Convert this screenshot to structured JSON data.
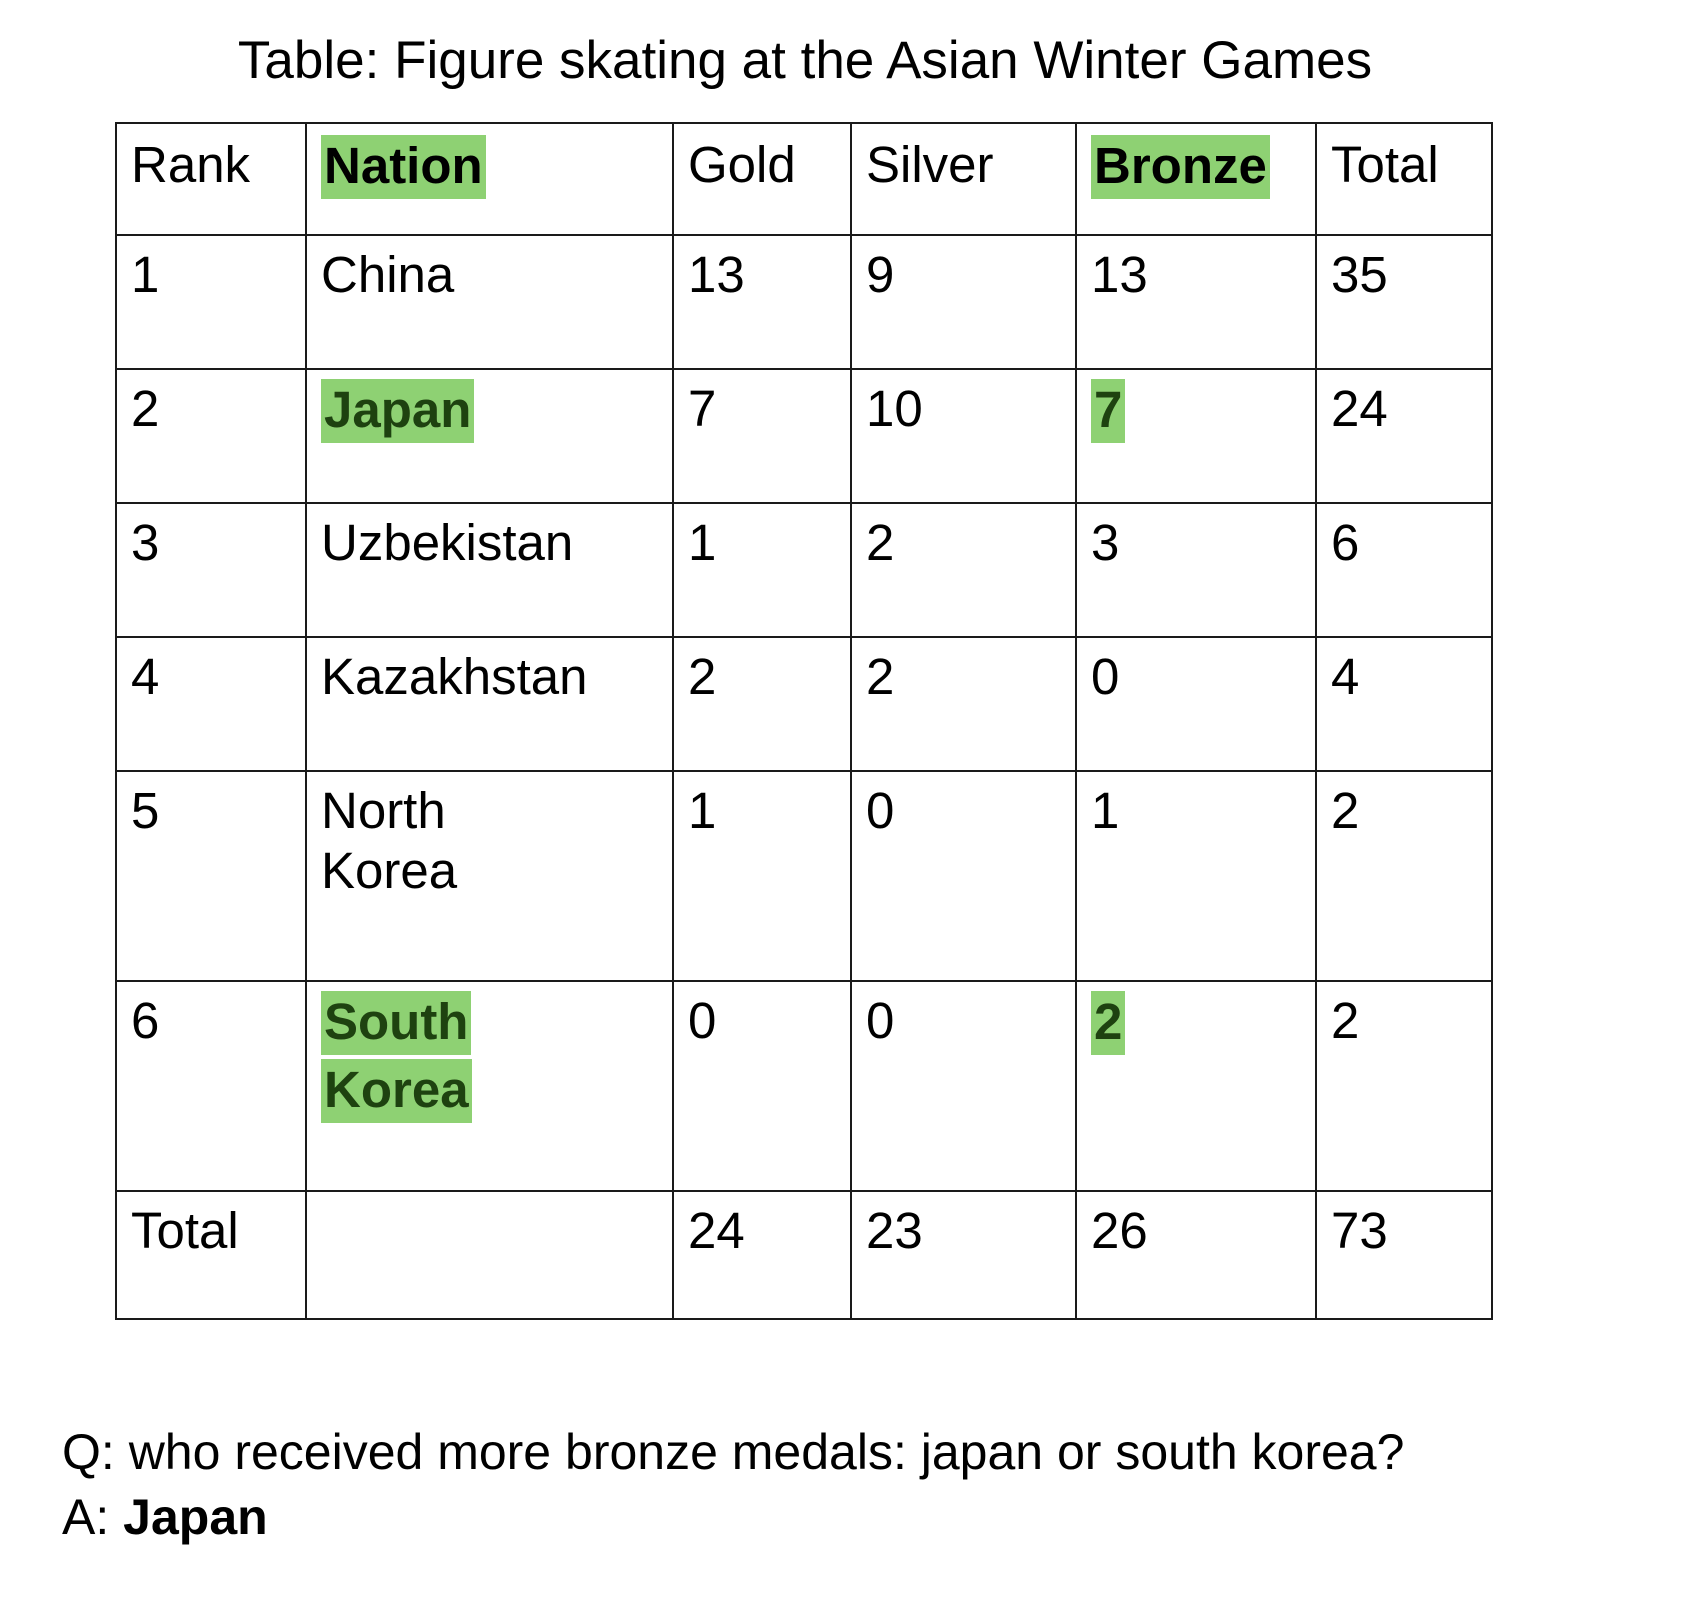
{
  "title": "Table: Figure skating at the Asian Winter Games",
  "highlight_color": "#8ed173",
  "highlight_text_color": "#1e4210",
  "table": {
    "columns": [
      {
        "key": "rank",
        "label": "Rank",
        "highlighted": false
      },
      {
        "key": "nation",
        "label": "Nation",
        "highlighted": true
      },
      {
        "key": "gold",
        "label": "Gold",
        "highlighted": false
      },
      {
        "key": "silver",
        "label": "Silver",
        "highlighted": false
      },
      {
        "key": "bronze",
        "label": "Bronze",
        "highlighted": true
      },
      {
        "key": "total",
        "label": "Total",
        "highlighted": false
      }
    ],
    "rows": [
      {
        "rank": "1",
        "nation": "China",
        "nation_line2": "",
        "gold": "13",
        "silver": "9",
        "bronze": "13",
        "total": "35"
      },
      {
        "rank": "2",
        "nation": "Japan",
        "nation_line2": "",
        "gold": "7",
        "silver": "10",
        "bronze": "7",
        "total": "24"
      },
      {
        "rank": "3",
        "nation": "Uzbekistan",
        "nation_line2": "",
        "gold": "1",
        "silver": "2",
        "bronze": "3",
        "total": "6"
      },
      {
        "rank": "4",
        "nation": "Kazakhstan",
        "nation_line2": "",
        "gold": "2",
        "silver": "2",
        "bronze": "0",
        "total": "4"
      },
      {
        "rank": "5",
        "nation": "North",
        "nation_line2": "Korea",
        "gold": "1",
        "silver": "0",
        "bronze": "1",
        "total": "2"
      },
      {
        "rank": "6",
        "nation": "South",
        "nation_line2": "Korea",
        "gold": "0",
        "silver": "0",
        "bronze": "2",
        "total": "2"
      }
    ],
    "total_row": {
      "rank": "Total",
      "nation": "",
      "gold": "24",
      "silver": "23",
      "bronze": "26",
      "total": "73"
    }
  },
  "qa": {
    "question_prefix": "Q:",
    "question": "who received more bronze medals: japan or south korea?",
    "answer_prefix": "A:",
    "answer": "Japan"
  },
  "chart_data": {
    "type": "table",
    "title": "Table: Figure skating at the Asian Winter Games",
    "columns": [
      "Rank",
      "Nation",
      "Gold",
      "Silver",
      "Bronze",
      "Total"
    ],
    "rows": [
      [
        "1",
        "China",
        13,
        9,
        13,
        35
      ],
      [
        "2",
        "Japan",
        7,
        10,
        7,
        24
      ],
      [
        "3",
        "Uzbekistan",
        1,
        2,
        3,
        6
      ],
      [
        "4",
        "Kazakhstan",
        2,
        2,
        0,
        4
      ],
      [
        "5",
        "North Korea",
        1,
        0,
        1,
        2
      ],
      [
        "6",
        "South Korea",
        0,
        0,
        2,
        2
      ],
      [
        "Total",
        "",
        24,
        23,
        26,
        73
      ]
    ],
    "highlighted_cells": [
      "Nation header",
      "Bronze header",
      "Japan",
      "Japan bronze 7",
      "South Korea",
      "South Korea bronze 2"
    ]
  }
}
